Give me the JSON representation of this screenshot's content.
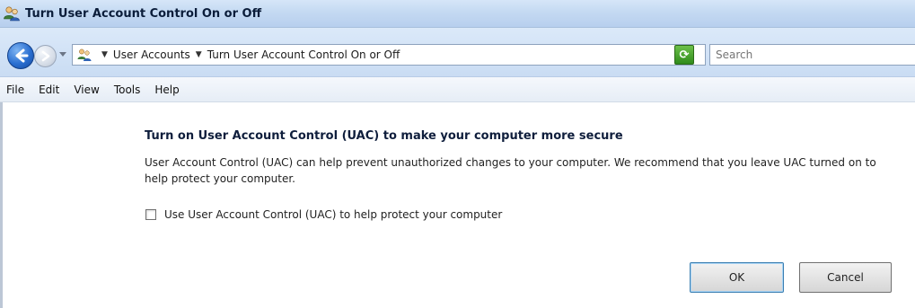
{
  "window": {
    "title": "Turn User Account Control On or Off",
    "title_icon": "user-accounts-icon"
  },
  "address_bar": {
    "breadcrumbs": [
      "User Accounts",
      "Turn User Account Control On or Off"
    ],
    "search_placeholder": "Search"
  },
  "menu": {
    "items": [
      "File",
      "Edit",
      "View",
      "Tools",
      "Help"
    ]
  },
  "content": {
    "heading": "Turn on User Account Control (UAC) to make your computer more secure",
    "description": "User Account Control (UAC) can help prevent unauthorized changes to your computer.  We recommend that you leave UAC turned on to help protect your computer.",
    "checkbox_label": "Use User Account Control (UAC) to help protect your computer",
    "checkbox_checked": false
  },
  "buttons": {
    "ok": "OK",
    "cancel": "Cancel"
  },
  "colors": {
    "accent": "#2a6fd1",
    "heading": "#0f1e3c"
  }
}
